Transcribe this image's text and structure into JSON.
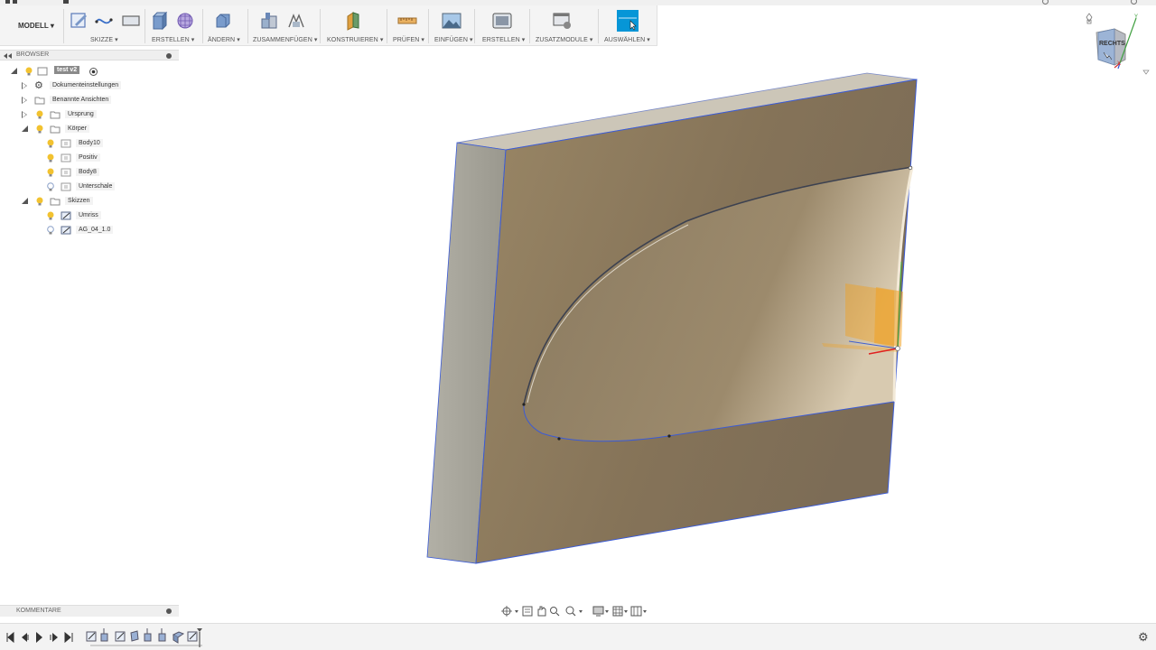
{
  "toolbar": {
    "mode": "MODELL",
    "groups": [
      {
        "label": "SKIZZE"
      },
      {
        "label": "ERSTELLEN"
      },
      {
        "label": "ÄNDERN"
      },
      {
        "label": "ZUSAMMENFÜGEN"
      },
      {
        "label": "KONSTRUIEREN"
      },
      {
        "label": "PRÜFEN"
      },
      {
        "label": "EINFÜGEN"
      },
      {
        "label": "ERSTELLEN"
      },
      {
        "label": "ZUSATZMODULE"
      },
      {
        "label": "AUSWÄHLEN"
      }
    ]
  },
  "browser": {
    "title": "BROWSER",
    "root": "test v2",
    "items": [
      {
        "label": "Dokumenteinstellungen"
      },
      {
        "label": "Benannte Ansichten"
      },
      {
        "label": "Ursprung"
      },
      {
        "label": "Körper"
      },
      {
        "label": "Body10"
      },
      {
        "label": "Positiv"
      },
      {
        "label": "Body8"
      },
      {
        "label": "Unterschale"
      },
      {
        "label": "Skizzen"
      },
      {
        "label": "Umriss"
      },
      {
        "label": "AG_04_1.0"
      }
    ]
  },
  "comments": {
    "title": "KOMMENTARE"
  },
  "viewcube": {
    "face": "RECHTS",
    "axes": [
      "X",
      "Y",
      "Z"
    ]
  },
  "colors": {
    "accent": "#0696d7",
    "toolbar_bg": "#f4f4f4",
    "body_face": "#8a7a62",
    "body_side": "#a3a096",
    "edge_blue": "#3b5bd6",
    "bulb": "#f2c230"
  },
  "icons": [
    "sketch-icon",
    "extrude-icon",
    "box-icon",
    "modify-icon",
    "joint-icon",
    "plane-icon",
    "measure-icon",
    "insert-image-icon",
    "render-icon",
    "addins-icon",
    "select-icon",
    "home-icon",
    "gear-icon"
  ]
}
